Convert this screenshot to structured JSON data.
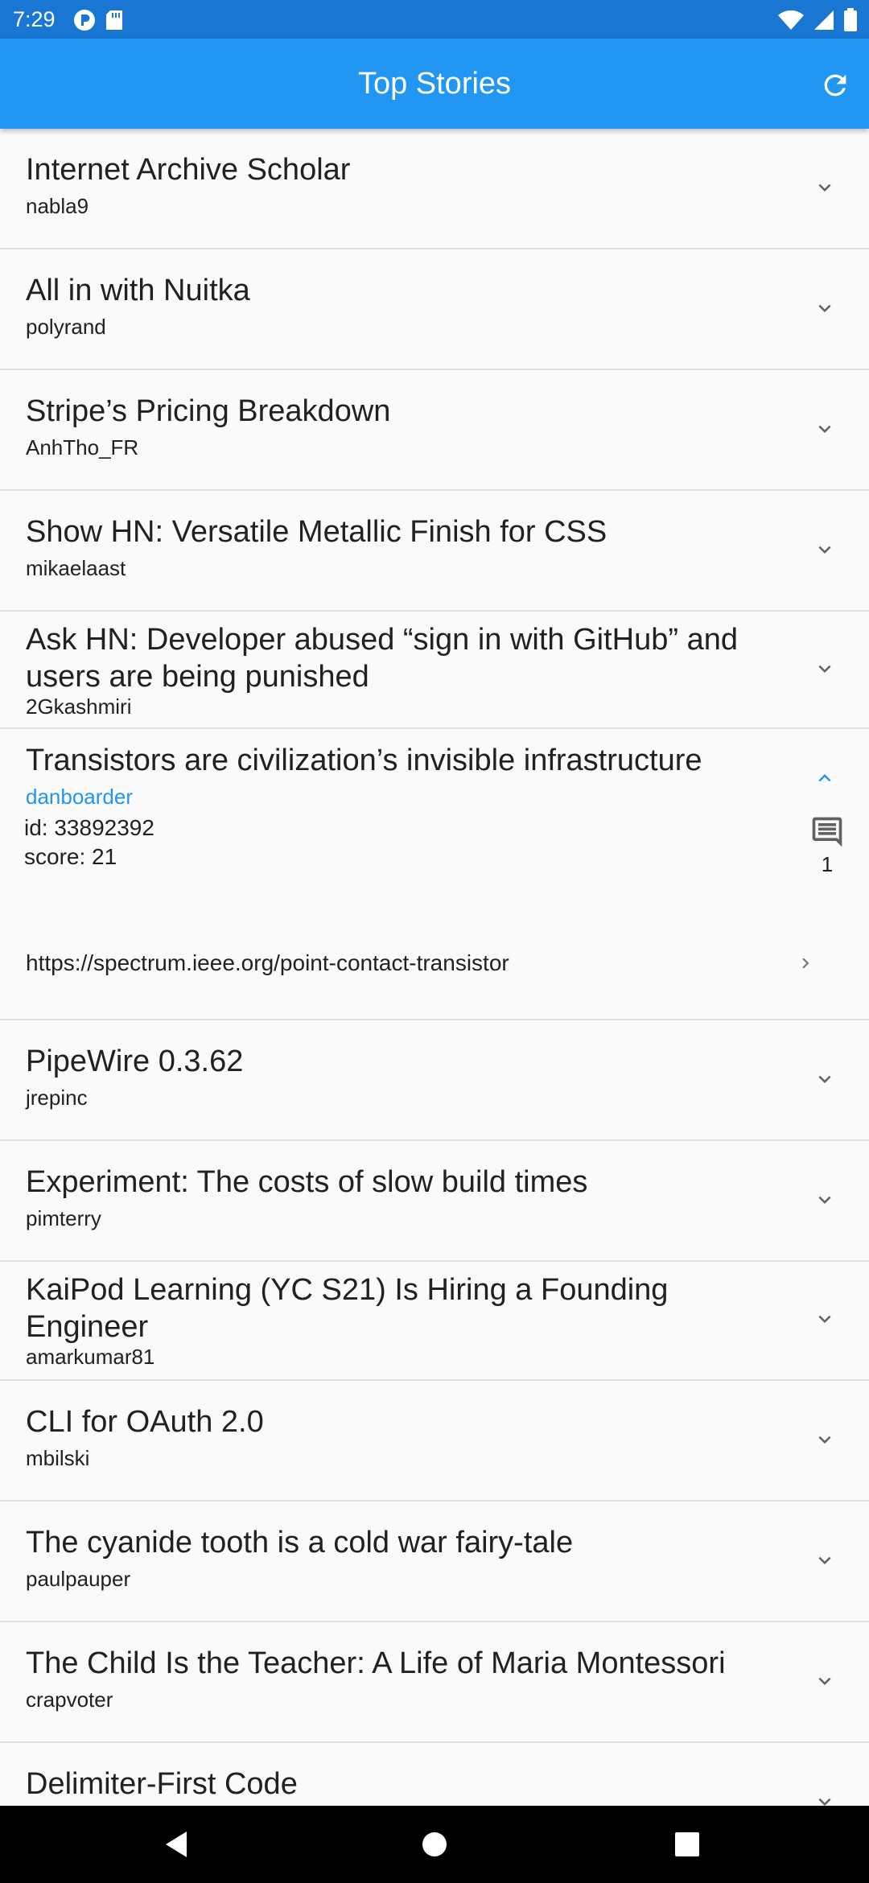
{
  "status_bar": {
    "time": "7:29",
    "icons": [
      "p-icon",
      "sd-card-icon",
      "wifi-icon",
      "signal-icon",
      "battery-icon"
    ]
  },
  "app_bar": {
    "title": "Top Stories",
    "refresh_icon": "refresh-icon"
  },
  "colors": {
    "app_bar": "#2196F3",
    "status_bar": "#1976D2",
    "accent": "#2196F3",
    "divider": "#e0e0e0",
    "background": "#fafafa"
  },
  "stories": [
    {
      "title": "Internet Archive Scholar",
      "author": "nabla9"
    },
    {
      "title": "All in with Nuitka",
      "author": "polyrand"
    },
    {
      "title": "Stripe’s Pricing Breakdown",
      "author": "AnhTho_FR"
    },
    {
      "title": "Show HN: Versatile Metallic Finish for CSS",
      "author": "mikaelaast"
    },
    {
      "title": "Ask HN: Developer abused “sign in with GitHub” and users are being punished",
      "author": "2Gkashmiri"
    },
    {
      "title": "Transistors are civilization’s invisible infrastructure",
      "author": "danboarder",
      "expanded": true,
      "id_text": "id: 33892392",
      "score_text": "score: 21",
      "comments": "1",
      "url": "https://spectrum.ieee.org/point-contact-transistor"
    },
    {
      "title": "PipeWire 0.3.62",
      "author": "jrepinc"
    },
    {
      "title": "Experiment: The costs of slow build times",
      "author": "pimterry"
    },
    {
      "title": "KaiPod Learning (YC S21) Is Hiring a Founding Engineer",
      "author": "amarkumar81"
    },
    {
      "title": "CLI for OAuth 2.0",
      "author": "mbilski"
    },
    {
      "title": "The cyanide tooth is a cold war fairy-tale",
      "author": "paulpauper"
    },
    {
      "title": "The Child Is the Teacher: A Life of Maria Montessori",
      "author": "crapvoter"
    },
    {
      "title": "Delimiter-First Code",
      "author": ""
    }
  ],
  "nav_bar": {
    "icons": [
      "back-icon",
      "home-icon",
      "recents-icon"
    ]
  }
}
